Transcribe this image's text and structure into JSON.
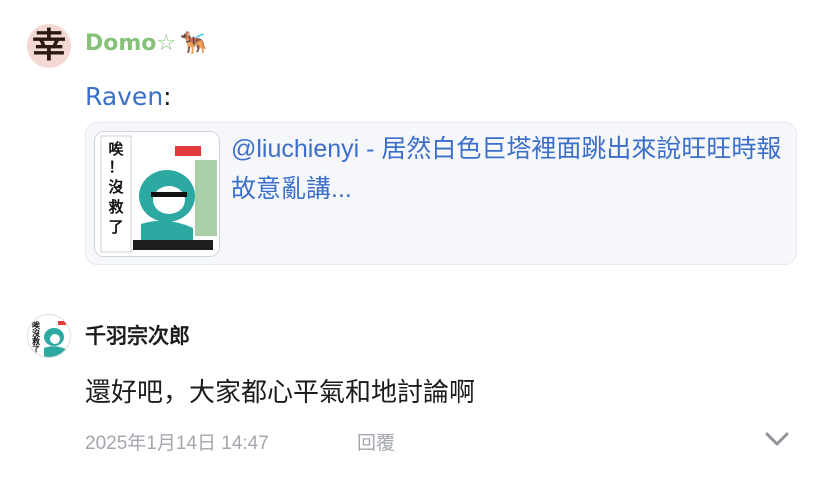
{
  "top_comment": {
    "avatar_glyph": "幸",
    "author_name": "Domo☆",
    "author_emoji": "🐕‍🦺",
    "reply_prefix": "",
    "reply_name": "Raven",
    "reply_colon": ":",
    "quote": {
      "text": "@liuchienyi - 居然白色巨塔裡面跳出來說旺旺時報故意亂講...",
      "thumb_lines": [
        "唉",
        "！",
        "沒",
        "救",
        "了"
      ]
    }
  },
  "second_comment": {
    "author_name": "千羽宗次郎",
    "avatar_lines": [
      "唉",
      "沒",
      "救",
      "了"
    ],
    "body": "還好吧，大家都心平氣和地討論啊",
    "timestamp": "2025年1月14日 14:47",
    "reply_label": "回覆",
    "expand_icon": "chevron-down-icon"
  },
  "colors": {
    "author_green": "#86c27a",
    "link_blue": "#3b6fc9",
    "meta_gray": "#a3a7ad",
    "card_bg": "#f6f7fa"
  }
}
